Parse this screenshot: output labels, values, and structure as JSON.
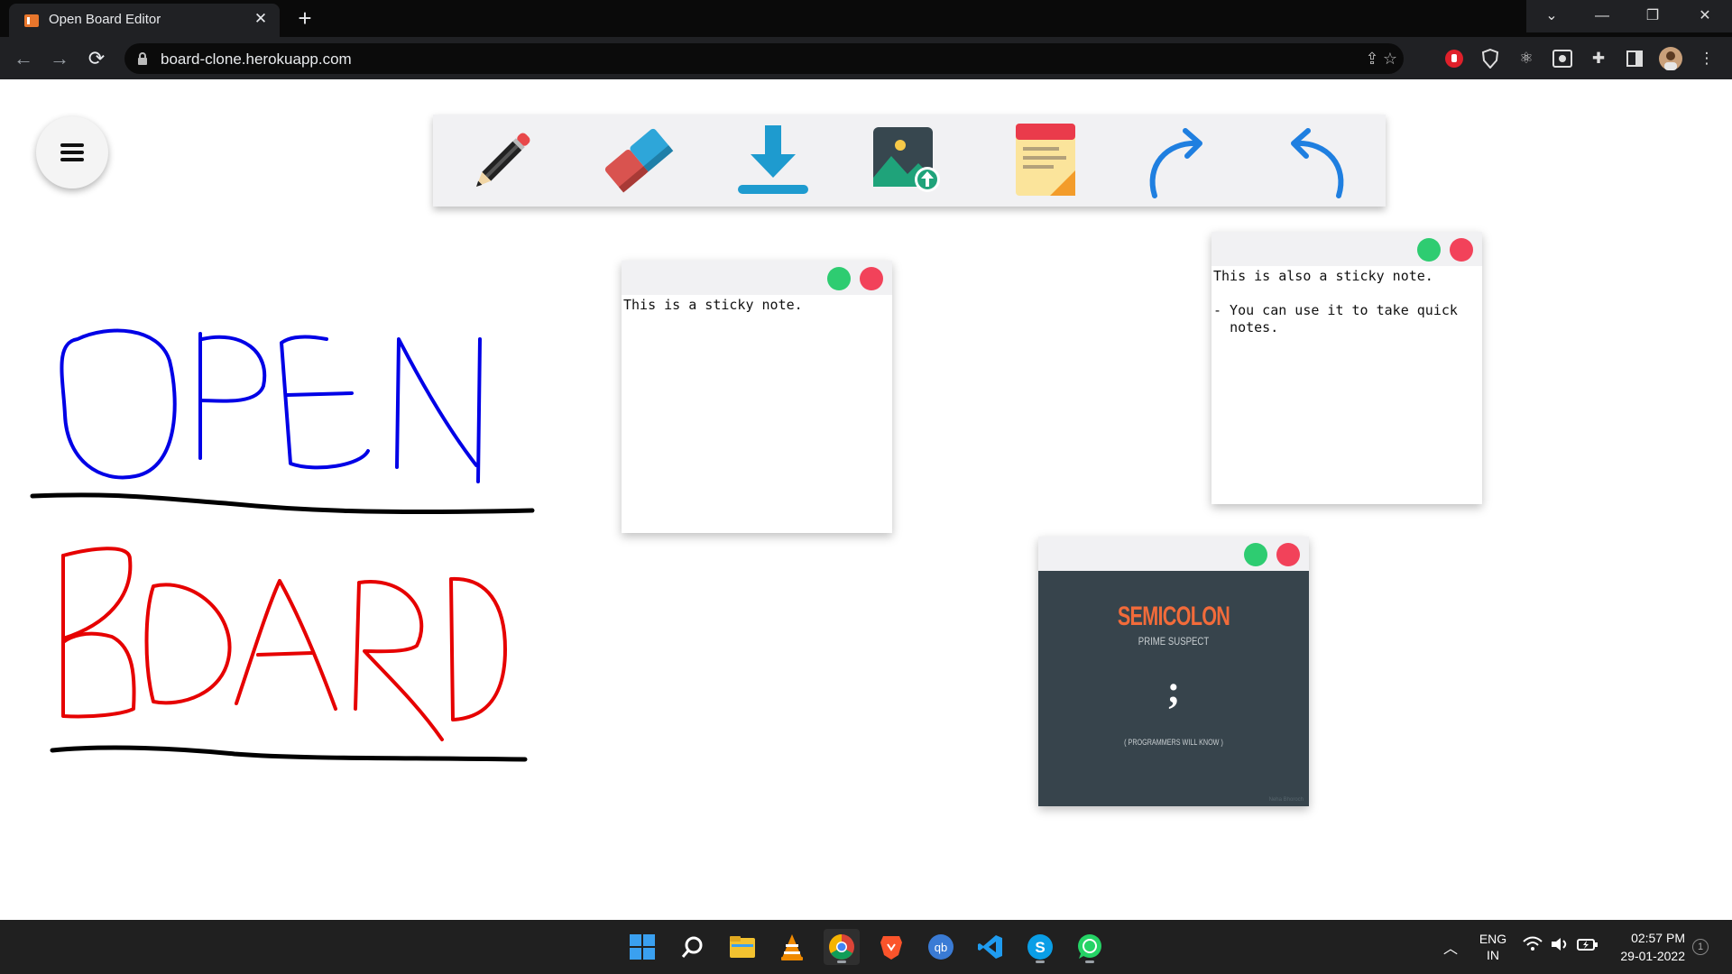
{
  "browser": {
    "tab_title": "Open Board Editor",
    "tab_close": "✕",
    "new_tab": "+",
    "url": "board-clone.herokuapp.com",
    "window_controls": [
      "⌄",
      "—",
      "❐",
      "✕"
    ],
    "nav": {
      "back": "←",
      "forward": "→",
      "reload": "⟳"
    }
  },
  "toolbar": {
    "tools": [
      {
        "name": "pencil-icon"
      },
      {
        "name": "eraser-icon"
      },
      {
        "name": "download-icon"
      },
      {
        "name": "image-upload-icon"
      },
      {
        "name": "sticky-note-icon"
      },
      {
        "name": "redo-icon"
      },
      {
        "name": "undo-icon"
      }
    ]
  },
  "sticky_notes": [
    {
      "text": "This is a sticky note."
    },
    {
      "text": "This is also a sticky note.\n\n- You can use it to take quick\n  notes."
    }
  ],
  "image_note": {
    "title": "SEMICOLON",
    "subtitle": "PRIME SUSPECT",
    "symbol": ";",
    "caption": "( PROGRAMMERS WILL KNOW )",
    "credit": "Neha Bhoroch"
  },
  "taskbar": {
    "language_top": "ENG",
    "language_bottom": "IN",
    "time": "02:57 PM",
    "date": "29-01-2022",
    "notification_count": "1"
  },
  "colors": {
    "drawing_blue": "#0000e6",
    "drawing_red": "#e60000",
    "close_dot": "#f2425a",
    "open_dot": "#2ecc71"
  }
}
